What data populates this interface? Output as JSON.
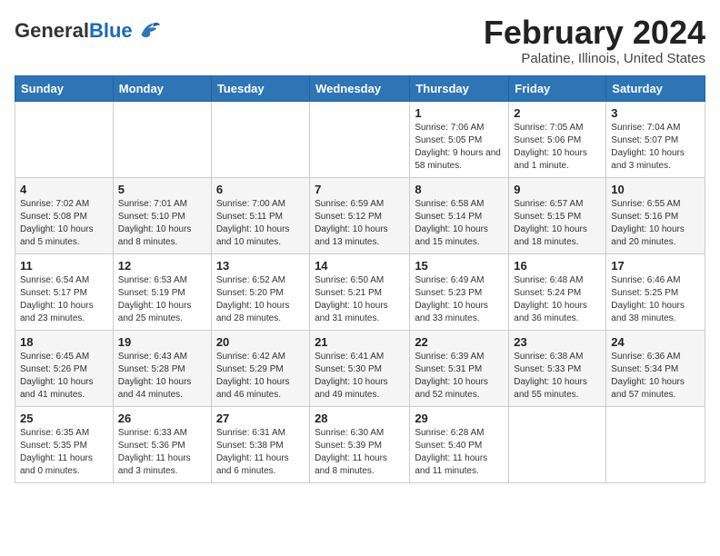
{
  "logo": {
    "general": "General",
    "blue": "Blue"
  },
  "header": {
    "month": "February 2024",
    "location": "Palatine, Illinois, United States"
  },
  "days_of_week": [
    "Sunday",
    "Monday",
    "Tuesday",
    "Wednesday",
    "Thursday",
    "Friday",
    "Saturday"
  ],
  "weeks": [
    [
      {
        "day": "",
        "info": ""
      },
      {
        "day": "",
        "info": ""
      },
      {
        "day": "",
        "info": ""
      },
      {
        "day": "",
        "info": ""
      },
      {
        "day": "1",
        "info": "Sunrise: 7:06 AM\nSunset: 5:05 PM\nDaylight: 9 hours and 58 minutes."
      },
      {
        "day": "2",
        "info": "Sunrise: 7:05 AM\nSunset: 5:06 PM\nDaylight: 10 hours and 1 minute."
      },
      {
        "day": "3",
        "info": "Sunrise: 7:04 AM\nSunset: 5:07 PM\nDaylight: 10 hours and 3 minutes."
      }
    ],
    [
      {
        "day": "4",
        "info": "Sunrise: 7:02 AM\nSunset: 5:08 PM\nDaylight: 10 hours and 5 minutes."
      },
      {
        "day": "5",
        "info": "Sunrise: 7:01 AM\nSunset: 5:10 PM\nDaylight: 10 hours and 8 minutes."
      },
      {
        "day": "6",
        "info": "Sunrise: 7:00 AM\nSunset: 5:11 PM\nDaylight: 10 hours and 10 minutes."
      },
      {
        "day": "7",
        "info": "Sunrise: 6:59 AM\nSunset: 5:12 PM\nDaylight: 10 hours and 13 minutes."
      },
      {
        "day": "8",
        "info": "Sunrise: 6:58 AM\nSunset: 5:14 PM\nDaylight: 10 hours and 15 minutes."
      },
      {
        "day": "9",
        "info": "Sunrise: 6:57 AM\nSunset: 5:15 PM\nDaylight: 10 hours and 18 minutes."
      },
      {
        "day": "10",
        "info": "Sunrise: 6:55 AM\nSunset: 5:16 PM\nDaylight: 10 hours and 20 minutes."
      }
    ],
    [
      {
        "day": "11",
        "info": "Sunrise: 6:54 AM\nSunset: 5:17 PM\nDaylight: 10 hours and 23 minutes."
      },
      {
        "day": "12",
        "info": "Sunrise: 6:53 AM\nSunset: 5:19 PM\nDaylight: 10 hours and 25 minutes."
      },
      {
        "day": "13",
        "info": "Sunrise: 6:52 AM\nSunset: 5:20 PM\nDaylight: 10 hours and 28 minutes."
      },
      {
        "day": "14",
        "info": "Sunrise: 6:50 AM\nSunset: 5:21 PM\nDaylight: 10 hours and 31 minutes."
      },
      {
        "day": "15",
        "info": "Sunrise: 6:49 AM\nSunset: 5:23 PM\nDaylight: 10 hours and 33 minutes."
      },
      {
        "day": "16",
        "info": "Sunrise: 6:48 AM\nSunset: 5:24 PM\nDaylight: 10 hours and 36 minutes."
      },
      {
        "day": "17",
        "info": "Sunrise: 6:46 AM\nSunset: 5:25 PM\nDaylight: 10 hours and 38 minutes."
      }
    ],
    [
      {
        "day": "18",
        "info": "Sunrise: 6:45 AM\nSunset: 5:26 PM\nDaylight: 10 hours and 41 minutes."
      },
      {
        "day": "19",
        "info": "Sunrise: 6:43 AM\nSunset: 5:28 PM\nDaylight: 10 hours and 44 minutes."
      },
      {
        "day": "20",
        "info": "Sunrise: 6:42 AM\nSunset: 5:29 PM\nDaylight: 10 hours and 46 minutes."
      },
      {
        "day": "21",
        "info": "Sunrise: 6:41 AM\nSunset: 5:30 PM\nDaylight: 10 hours and 49 minutes."
      },
      {
        "day": "22",
        "info": "Sunrise: 6:39 AM\nSunset: 5:31 PM\nDaylight: 10 hours and 52 minutes."
      },
      {
        "day": "23",
        "info": "Sunrise: 6:38 AM\nSunset: 5:33 PM\nDaylight: 10 hours and 55 minutes."
      },
      {
        "day": "24",
        "info": "Sunrise: 6:36 AM\nSunset: 5:34 PM\nDaylight: 10 hours and 57 minutes."
      }
    ],
    [
      {
        "day": "25",
        "info": "Sunrise: 6:35 AM\nSunset: 5:35 PM\nDaylight: 11 hours and 0 minutes."
      },
      {
        "day": "26",
        "info": "Sunrise: 6:33 AM\nSunset: 5:36 PM\nDaylight: 11 hours and 3 minutes."
      },
      {
        "day": "27",
        "info": "Sunrise: 6:31 AM\nSunset: 5:38 PM\nDaylight: 11 hours and 6 minutes."
      },
      {
        "day": "28",
        "info": "Sunrise: 6:30 AM\nSunset: 5:39 PM\nDaylight: 11 hours and 8 minutes."
      },
      {
        "day": "29",
        "info": "Sunrise: 6:28 AM\nSunset: 5:40 PM\nDaylight: 11 hours and 11 minutes."
      },
      {
        "day": "",
        "info": ""
      },
      {
        "day": "",
        "info": ""
      }
    ]
  ]
}
